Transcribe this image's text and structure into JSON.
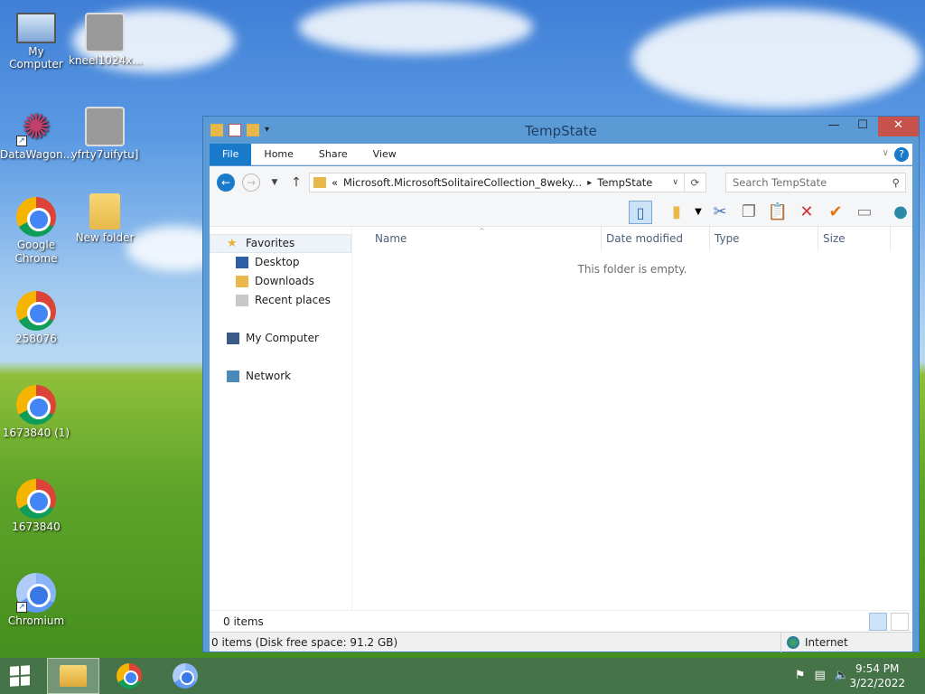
{
  "desktop": {
    "icons": [
      {
        "label": "My Computer"
      },
      {
        "label": "kneel1024x..."
      },
      {
        "label": "DataWagon..."
      },
      {
        "label": "yfrty7uifytu]"
      },
      {
        "label": "Google Chrome"
      },
      {
        "label": "New folder"
      },
      {
        "label": "258076"
      },
      {
        "label": "1673840 (1)"
      },
      {
        "label": "1673840"
      },
      {
        "label": "Chromium"
      }
    ]
  },
  "window": {
    "title": "TempState",
    "controls": {
      "minimize": "—",
      "maximize": "☐",
      "close": "✕"
    },
    "ribbon_tabs": [
      "File",
      "Home",
      "Share",
      "View"
    ],
    "help": "?",
    "address": {
      "prefix": "«",
      "segment1": "Microsoft.MicrosoftSolitaireCollection_8weky...",
      "separator": "▸",
      "segment2": "TempState"
    },
    "search_placeholder": "Search TempState",
    "nav": {
      "favorites": "Favorites",
      "desktop": "Desktop",
      "downloads": "Downloads",
      "recent": "Recent places",
      "computer": "My Computer",
      "network": "Network"
    },
    "columns": [
      "Name",
      "Date modified",
      "Type",
      "Size"
    ],
    "empty_message": "This folder is empty.",
    "item_count": "0 items",
    "status_detail": "0 items (Disk free space: 91.2 GB)",
    "zone": "Internet"
  },
  "taskbar": {
    "time": "9:54 PM",
    "date": "3/22/2022"
  }
}
